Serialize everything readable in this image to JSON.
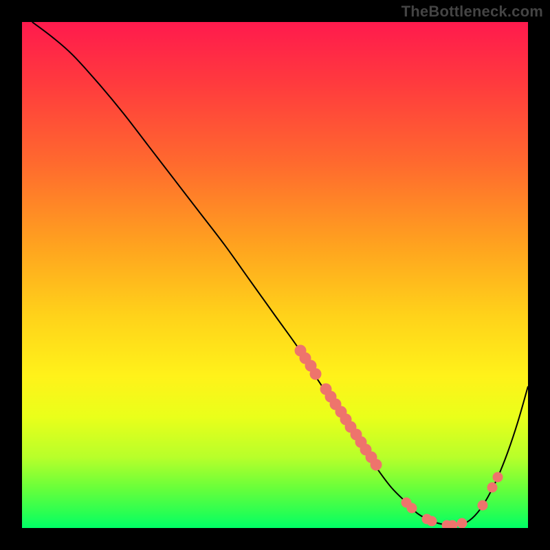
{
  "attribution": "TheBottleneck.com",
  "chart_data": {
    "type": "line",
    "title": "",
    "xlabel": "",
    "ylabel": "",
    "xlim": [
      0,
      100
    ],
    "ylim": [
      0,
      100
    ],
    "curve": {
      "x": [
        2,
        6,
        10,
        15,
        20,
        25,
        30,
        35,
        40,
        45,
        50,
        55,
        58,
        62,
        66,
        70,
        73,
        76,
        78,
        80,
        82,
        84,
        86,
        88,
        90,
        92,
        94,
        96,
        98,
        100
      ],
      "y": [
        100,
        97,
        93.5,
        88,
        82,
        75.5,
        69,
        62.5,
        56,
        49,
        42,
        35,
        30,
        24,
        18,
        12,
        8,
        5,
        3,
        1.8,
        1.0,
        0.6,
        0.6,
        1.2,
        3.0,
        6.0,
        10.0,
        15.0,
        21.0,
        28.0
      ]
    },
    "markers": {
      "cluster_left": [
        {
          "x": 55,
          "y": 35.0
        },
        {
          "x": 56,
          "y": 33.5
        },
        {
          "x": 57,
          "y": 32.0
        },
        {
          "x": 58,
          "y": 30.5
        },
        {
          "x": 60,
          "y": 27.5
        },
        {
          "x": 61,
          "y": 26.0
        },
        {
          "x": 62,
          "y": 24.5
        },
        {
          "x": 63,
          "y": 23.0
        },
        {
          "x": 64,
          "y": 21.5
        },
        {
          "x": 65,
          "y": 20.0
        },
        {
          "x": 66,
          "y": 18.5
        },
        {
          "x": 67,
          "y": 17.0
        },
        {
          "x": 68,
          "y": 15.5
        },
        {
          "x": 69,
          "y": 14.0
        },
        {
          "x": 70,
          "y": 12.5
        }
      ],
      "bottom": [
        {
          "x": 76,
          "y": 5.0
        },
        {
          "x": 77,
          "y": 4.0
        },
        {
          "x": 80,
          "y": 1.8
        },
        {
          "x": 81,
          "y": 1.3
        },
        {
          "x": 84,
          "y": 0.6
        },
        {
          "x": 85,
          "y": 0.6
        },
        {
          "x": 87,
          "y": 0.9
        }
      ],
      "right": [
        {
          "x": 91,
          "y": 4.5
        },
        {
          "x": 93,
          "y": 8.0
        },
        {
          "x": 94,
          "y": 10.0
        }
      ]
    },
    "colors": {
      "curve": "#000000",
      "marker": "#ee746c",
      "gradient_top": "#ff1a4d",
      "gradient_bottom": "#00ff66"
    }
  }
}
